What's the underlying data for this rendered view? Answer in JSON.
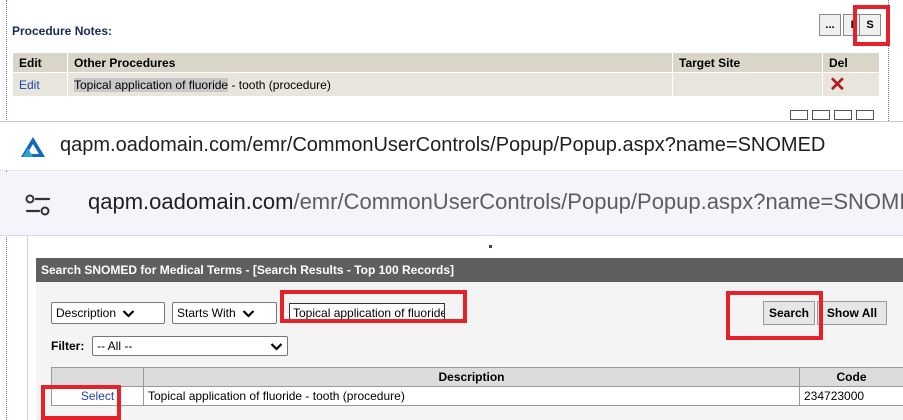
{
  "procedure_notes": {
    "title": "Procedure Notes:",
    "buttons": {
      "ellipsis": "...",
      "l": "L",
      "s": "S"
    },
    "columns": {
      "edit": "Edit",
      "other_procedures": "Other Procedures",
      "target_site": "Target Site",
      "del": "Del"
    },
    "row": {
      "edit": "Edit",
      "procedure_highlight": "Topical application of fluoride",
      "procedure_rest": " - tooth (procedure)",
      "target_site": "",
      "delete_glyph": "✕"
    }
  },
  "browser": {
    "url_bar_1": "qapm.oadomain.com/emr/CommonUserControls/Popup/Popup.aspx?name=SNOMED",
    "url_bar_2_host": "qapm.oadomain.com",
    "url_bar_2_path": "/emr/CommonUserControls/Popup/Popup.aspx?name=SNOMED"
  },
  "popup": {
    "header": "Search SNOMED for Medical Terms - [Search Results - Top 100 Records]",
    "field_select": "Description",
    "match_select": "Starts With",
    "search_value": "Topical application of fluoride",
    "search_button": "Search",
    "show_all_button": "Show All",
    "filter_label": "Filter:",
    "filter_value": "-- All --",
    "results": {
      "columns": [
        "",
        "Description",
        "Code"
      ],
      "rows": [
        {
          "action": "Select",
          "description": "Topical application of fluoride - tooth (procedure)",
          "code": "234723000"
        }
      ]
    }
  },
  "colors": {
    "highlight_red": "#e5222a",
    "link_blue": "#2440b0",
    "header_gray": "#5f5f5f"
  },
  "icons": [
    "brand-logo-icon",
    "site-settings-icon",
    "chevron-down-icon",
    "delete-x-icon"
  ]
}
